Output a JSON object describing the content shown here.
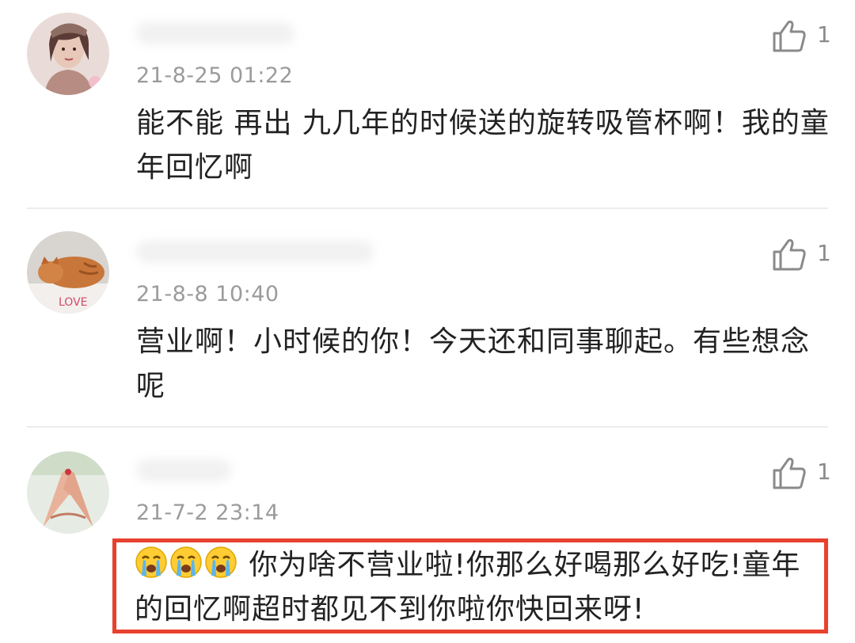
{
  "comments": [
    {
      "timestamp": "21-8-25 01:22",
      "likes": "1",
      "text": "能不能 再出 九几年的时候送的旋转吸管杯啊！我的童年回忆啊",
      "avatar_icon": "woman-illustration-avatar"
    },
    {
      "timestamp": "21-8-8 10:40",
      "likes": "1",
      "text": "营业啊！小时候的你！今天还和同事聊起。有些想念呢",
      "avatar_icon": "sleeping-cat-avatar"
    },
    {
      "timestamp": "21-7-2 23:14",
      "likes": "1",
      "text": "你为啥不营业啦!你那么好喝那么好吃!童年的回忆啊超时都见不到你啦你快回来呀!",
      "emoji": [
        "loudly-crying-face",
        "loudly-crying-face",
        "loudly-crying-face"
      ],
      "avatar_icon": "hands-gesture-avatar"
    }
  ],
  "colors": {
    "highlight_border": "#e8412e",
    "timestamp": "#9b9b9b",
    "text": "#222222",
    "divider": "#ececec"
  }
}
